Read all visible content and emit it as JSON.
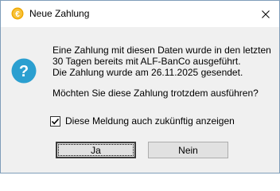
{
  "window": {
    "title": "Neue Zahlung",
    "app_icon": "euro-coin-icon",
    "close_icon": "close-icon",
    "close_glyph": "✕"
  },
  "dialog": {
    "icon": "question-icon",
    "icon_glyph": "?",
    "message_lines": [
      "Eine Zahlung mit diesen Daten wurde in den letzten",
      "30 Tagen bereits mit ALF-BanCo ausgeführt.",
      "Die Zahlung wurde am 26.11.2025 gesendet."
    ],
    "question": "Möchten Sie diese Zahlung trotzdem ausführen?",
    "checkbox": {
      "label": "Diese Meldung auch zukünftig anzeigen",
      "checked": true,
      "check_glyph": "✓"
    },
    "buttons": {
      "yes": "Ja",
      "no": "Nein"
    }
  },
  "colors": {
    "accent_icon": "#2b9fd0",
    "euro_coin": "#f0a800",
    "dialog_background": "#f0f0f0",
    "button_background": "#e1e1e1"
  }
}
